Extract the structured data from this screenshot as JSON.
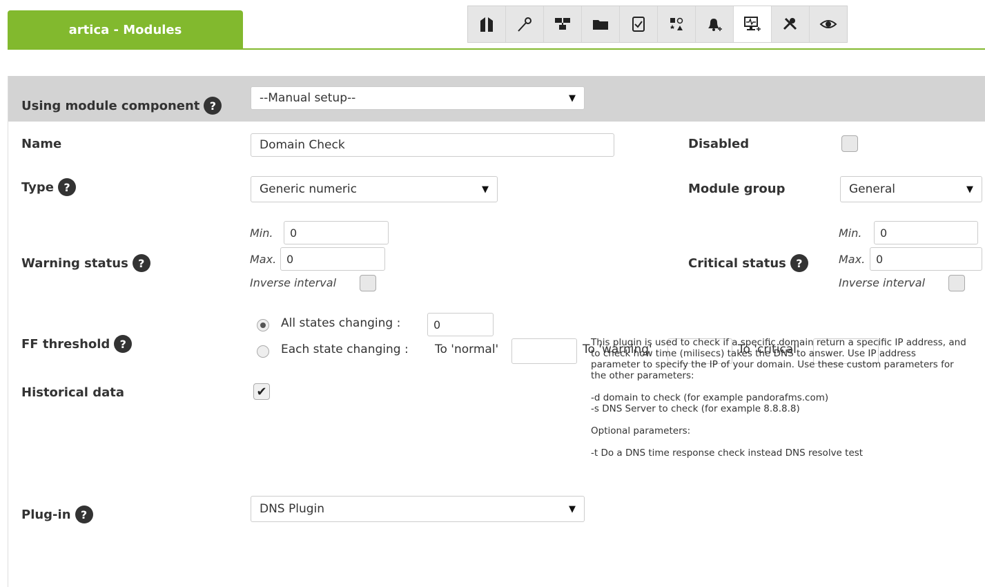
{
  "header": {
    "tab_title": "artica - Modules",
    "toolbar_icons": [
      "manage-agent-icon",
      "module-wand-icon",
      "network-icon",
      "folder-icon",
      "checklist-icon",
      "shapes-icon",
      "alert-add-icon",
      "module-add-icon",
      "tools-icon",
      "view-icon"
    ],
    "active_toolbar_index": 7
  },
  "form": {
    "component": {
      "label": "Using module component",
      "value": "--Manual setup--"
    },
    "name": {
      "label": "Name",
      "value": "Domain Check"
    },
    "disabled": {
      "label": "Disabled",
      "checked": false
    },
    "type": {
      "label": "Type",
      "value": "Generic numeric"
    },
    "module_group": {
      "label": "Module group",
      "value": "General"
    },
    "warning": {
      "label": "Warning status",
      "min_label": "Min.",
      "min": "0",
      "max_label": "Max.",
      "max": "0",
      "inverse_label": "Inverse interval"
    },
    "critical": {
      "label": "Critical status",
      "min_label": "Min.",
      "min": "0",
      "max_label": "Max.",
      "max": "0",
      "inverse_label": "Inverse interval"
    },
    "ff": {
      "label": "FF threshold",
      "all_label": "All states changing :",
      "all_value": "0",
      "each_label": "Each state changing :",
      "to_normal": "To 'normal'",
      "to_warning": "To 'warning'",
      "to_critical": "To 'critical'",
      "selected": "all"
    },
    "historical": {
      "label": "Historical data",
      "checked": true
    },
    "plugin": {
      "label": "Plug-in",
      "value": "DNS Plugin",
      "description": [
        "This plugin is used to check if a specific domain return a specific IP address, and to check how time (milisecs) takes the DNS to answer. Use IP address parameter to specify the IP of your domain. Use these custom parameters for the other parameters:",
        "-d domain to check (for example pandorafms.com)",
        "-s DNS Server to check (for example 8.8.8.8)",
        "Optional parameters:",
        "-t Do a DNS time response check instead DNS resolve test"
      ]
    },
    "help_glyph": "?"
  }
}
